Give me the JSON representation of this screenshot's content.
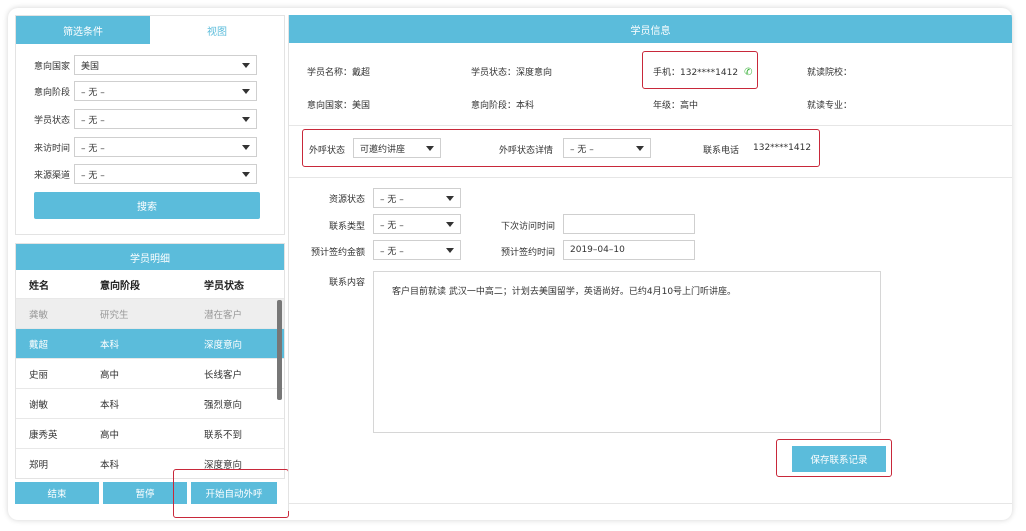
{
  "filter": {
    "tab_filter": "筛选条件",
    "tab_view": "视图",
    "rows": [
      {
        "label": "意向国家",
        "value": "美国"
      },
      {
        "label": "意向阶段",
        "value": "– 无 –"
      },
      {
        "label": "学员状态",
        "value": "– 无 –"
      },
      {
        "label": "来访时间",
        "value": "– 无 –"
      },
      {
        "label": "来源渠道",
        "value": "– 无 –"
      }
    ],
    "search_label": "搜索"
  },
  "student_list": {
    "title": "学员明细",
    "headers": [
      "姓名",
      "意向阶段",
      "学员状态"
    ],
    "rows": [
      {
        "name": "龚敏",
        "stage": "研究生",
        "status": "潜在客户"
      },
      {
        "name": "戴超",
        "stage": "本科",
        "status": "深度意向"
      },
      {
        "name": "史丽",
        "stage": "高中",
        "status": "长线客户"
      },
      {
        "name": "谢敏",
        "stage": "本科",
        "status": "强烈意向"
      },
      {
        "name": "康秀英",
        "stage": "高中",
        "status": "联系不到"
      },
      {
        "name": "郑明",
        "stage": "本科",
        "status": "深度意向"
      }
    ]
  },
  "bottom_buttons": {
    "end": "结束",
    "pause": "暂停",
    "auto_call": "开始自动外呼"
  },
  "student_info": {
    "title": "学员信息",
    "name": "学员名称：戴超",
    "status": "学员状态：深度意向",
    "phone": "手机：132****1412",
    "school": "就读院校：",
    "country": "意向国家：美国",
    "stage": "意向阶段：本科",
    "grade": "年级：高中",
    "major": "就读专业："
  },
  "call": {
    "status_label": "外呼状态",
    "status_value": "可邀约讲座",
    "detail_label": "外呼状态详情",
    "detail_value": "– 无 –",
    "contact_phone_label": "联系电话",
    "contact_phone_value": "132****1412"
  },
  "contact_form": {
    "resource_status_label": "资源状态",
    "resource_status_value": "– 无 –",
    "contact_type_label": "联系类型",
    "contact_type_value": "– 无 –",
    "next_visit_label": "下次访问时间",
    "next_visit_value": "",
    "sign_amount_label": "预计签约金额",
    "sign_amount_value": "– 无 –",
    "sign_date_label": "预计签约时间",
    "sign_date_value": "2019–04–10",
    "content_label": "联系内容",
    "content_value": "客户目前就读 武汉一中高二；计划去美国留学，英语尚好。已约4月10号上门听讲座。",
    "save_label": "保存联系记录"
  },
  "colors": {
    "accent": "#5bbcdb",
    "highlight": "#c8283a"
  }
}
